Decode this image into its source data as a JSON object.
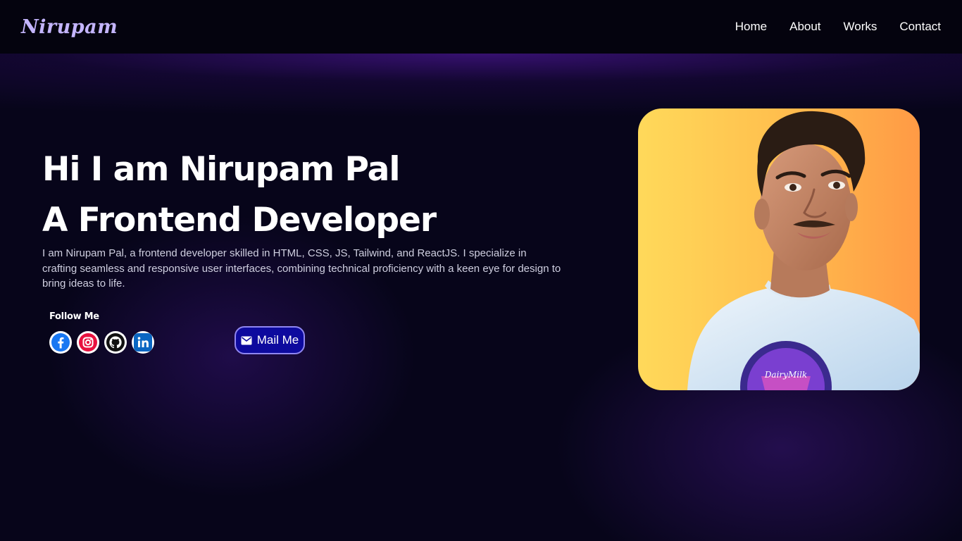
{
  "nav": {
    "logo": "Nirupam",
    "links": [
      "Home",
      "About",
      "Works",
      "Contact"
    ]
  },
  "hero": {
    "line1": "Hi I am Nirupam Pal",
    "line2": "A Frontend Developer",
    "description": "I am Nirupam Pal, a frontend developer skilled in HTML, CSS, JS, Tailwind, and ReactJS. I specialize in crafting seamless and responsive user interfaces, combining technical proficiency with a keen eye for design to bring ideas to life."
  },
  "follow": {
    "title": "Follow Me",
    "socials": [
      {
        "name": "facebook-icon",
        "color": "#1877f2"
      },
      {
        "name": "instagram-icon",
        "color": "#e4405f"
      },
      {
        "name": "github-icon",
        "color": "#111111"
      },
      {
        "name": "linkedin-icon",
        "color": "#0a66c2"
      }
    ]
  },
  "mail_button": {
    "label": "Mail Me",
    "icon": "mail-icon"
  },
  "portrait": {
    "shirt_badge_text": "DairyMilk"
  },
  "colors": {
    "background": "#07051a",
    "navbar": "#04030e",
    "logo": "#c4b5fd",
    "mail_button": "#0d0a9e",
    "mail_button_border": "#8f86f0"
  }
}
